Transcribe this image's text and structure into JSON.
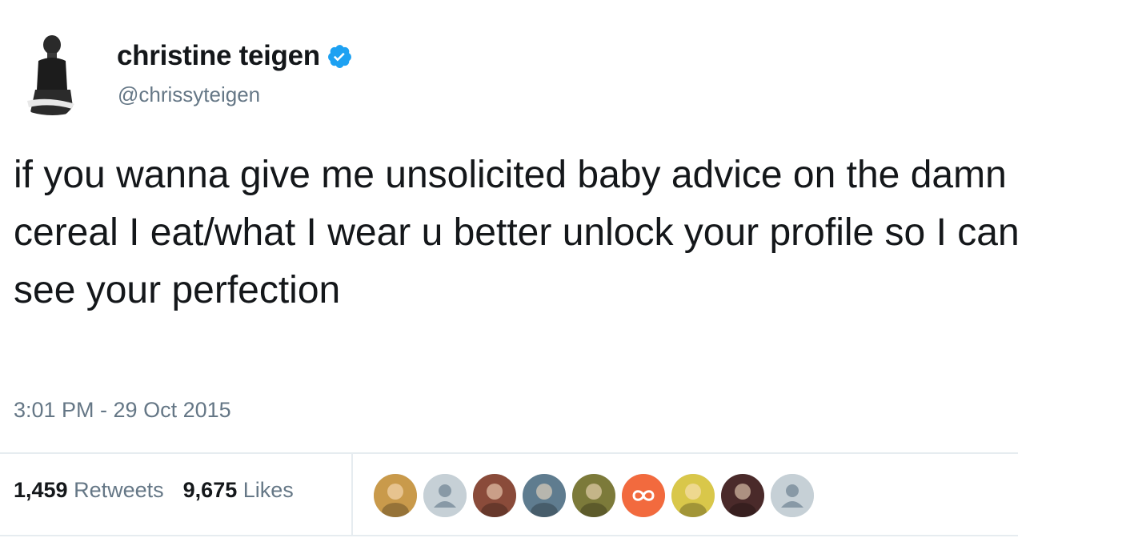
{
  "tweet": {
    "display_name": "christine teigen",
    "handle": "@chrissyteigen",
    "text": "if you wanna give me unsolicited baby advice on the damn cereal I eat/what I wear u better unlock your profile so I can see your perfection",
    "timestamp": "3:01 PM - 29 Oct 2015",
    "verified": true
  },
  "stats": {
    "retweets_count": "1,459",
    "retweets_label": "Retweets",
    "likes_count": "9,675",
    "likes_label": "Likes"
  },
  "likers": [
    {
      "kind": "photo",
      "color": "#c99a4b"
    },
    {
      "kind": "default",
      "color": "#c6d0d6"
    },
    {
      "kind": "photo",
      "color": "#8a4b3a"
    },
    {
      "kind": "photo",
      "color": "#5f7c8f"
    },
    {
      "kind": "photo",
      "color": "#7c7a3a"
    },
    {
      "kind": "logo",
      "color": "#f26a3e"
    },
    {
      "kind": "photo",
      "color": "#d9c74a"
    },
    {
      "kind": "photo",
      "color": "#4a2a2a"
    },
    {
      "kind": "default",
      "color": "#c6d0d6"
    }
  ],
  "colors": {
    "verified_blue": "#1da1f2",
    "secondary_text": "#657786",
    "primary_text": "#14171a",
    "divider": "#e6ecf0"
  },
  "icons": {
    "verified": "verified-badge-icon",
    "default_avatar": "default-avatar-icon"
  }
}
